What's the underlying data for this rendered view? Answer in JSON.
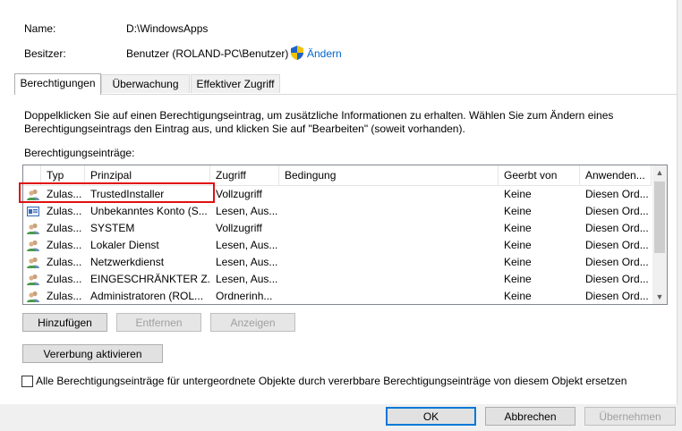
{
  "header": {
    "name_label": "Name:",
    "name_value": "D:\\WindowsApps",
    "owner_label": "Besitzer:",
    "owner_value": "Benutzer (ROLAND-PC\\Benutzer)",
    "change_link": "Ändern"
  },
  "tabs": [
    "Berechtigungen",
    "Überwachung",
    "Effektiver Zugriff"
  ],
  "info_text_1": "Doppelklicken Sie auf einen Berechtigungseintrag, um zusätzliche Informationen zu erhalten. Wählen Sie zum Ändern eines",
  "info_text_2": "Berechtigungseintrags den Eintrag aus, und klicken Sie auf \"Bearbeiten\" (soweit vorhanden).",
  "entries_label": "Berechtigungseinträge:",
  "columns": [
    "Typ",
    "Prinzipal",
    "Zugriff",
    "Bedingung",
    "Geerbt von",
    "Anwenden..."
  ],
  "rows": [
    {
      "typ": "Zulas...",
      "prinzipal": "TrustedInstaller",
      "zugriff": "Vollzugriff",
      "bedingung": "",
      "geerbt": "Keine",
      "anwenden": "Diesen Ord...",
      "icon": "group-icon"
    },
    {
      "typ": "Zulas...",
      "prinzipal": "Unbekanntes Konto (S...",
      "zugriff": "Lesen, Aus...",
      "bedingung": "",
      "geerbt": "Keine",
      "anwenden": "Diesen Ord...",
      "icon": "unknown-account-icon"
    },
    {
      "typ": "Zulas...",
      "prinzipal": "SYSTEM",
      "zugriff": "Vollzugriff",
      "bedingung": "",
      "geerbt": "Keine",
      "anwenden": "Diesen Ord...",
      "icon": "group-icon"
    },
    {
      "typ": "Zulas...",
      "prinzipal": "Lokaler Dienst",
      "zugriff": "Lesen, Aus...",
      "bedingung": "",
      "geerbt": "Keine",
      "anwenden": "Diesen Ord...",
      "icon": "group-icon"
    },
    {
      "typ": "Zulas...",
      "prinzipal": "Netzwerkdienst",
      "zugriff": "Lesen, Aus...",
      "bedingung": "",
      "geerbt": "Keine",
      "anwenden": "Diesen Ord...",
      "icon": "group-icon"
    },
    {
      "typ": "Zulas...",
      "prinzipal": "EINGESCHRÄNKTER Z...",
      "zugriff": "Lesen, Aus...",
      "bedingung": "",
      "geerbt": "Keine",
      "anwenden": "Diesen Ord...",
      "icon": "group-icon"
    },
    {
      "typ": "Zulas...",
      "prinzipal": "Administratoren (ROL...",
      "zugriff": "Ordnerinh...",
      "bedingung": "",
      "geerbt": "Keine",
      "anwenden": "Diesen Ord...",
      "icon": "group-icon"
    }
  ],
  "buttons": {
    "add": "Hinzufügen",
    "remove": "Entfernen",
    "view": "Anzeigen",
    "enable_inheritance": "Vererbung aktivieren",
    "ok": "OK",
    "cancel": "Abbrechen",
    "apply": "Übernehmen"
  },
  "replace_checkbox_label": "Alle Berechtigungseinträge für untergeordnete Objekte durch vererbbare Berechtigungseinträge von diesem Objekt ersetzen",
  "colors": {
    "link": "#0066cc",
    "highlight": "#e01010",
    "default_button_border": "#0078d7"
  }
}
